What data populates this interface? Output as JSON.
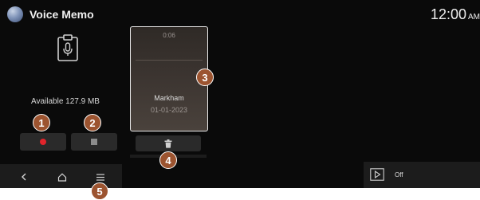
{
  "header": {
    "app_title": "Voice Memo",
    "clock_time": "12:00",
    "clock_ampm": "AM"
  },
  "storage": {
    "available_label": "Available 127.9 MB"
  },
  "controls": {
    "record_icon": "record-icon",
    "stop_icon": "stop-icon"
  },
  "memo": {
    "duration": "0:06",
    "name": "Markham",
    "date": "01-01-2023"
  },
  "delete": {
    "icon": "trash-icon"
  },
  "nav": {
    "back_icon": "chevron-left-icon",
    "home_icon": "home-icon",
    "menu_icon": "menu-icon"
  },
  "playback": {
    "icon": "play-icon",
    "repeat_state": "Off"
  },
  "markers": [
    "1",
    "2",
    "3",
    "4",
    "5"
  ],
  "colors": {
    "screen_bg": "#0a0a0a",
    "record_red": "#e0242b",
    "marker_bg": "#9c5430",
    "button_bg": "#2a2a2a"
  }
}
